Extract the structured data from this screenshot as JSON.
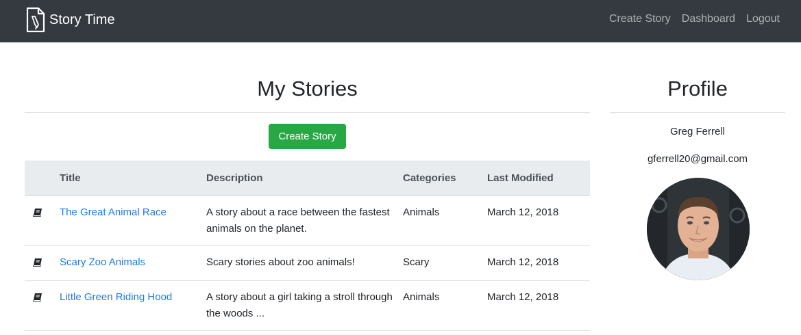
{
  "navbar": {
    "brand": "Story Time",
    "links": [
      "Create Story",
      "Dashboard",
      "Logout"
    ]
  },
  "main": {
    "title": "My Stories",
    "create_button": "Create Story",
    "table": {
      "headers": [
        "Title",
        "Description",
        "Categories",
        "Last Modified"
      ],
      "rows": [
        {
          "icon": "book-icon",
          "title": "The Great Animal Race",
          "description": "A story about a race between the fastest animals on the planet.",
          "category": "Animals",
          "modified": "March 12, 2018"
        },
        {
          "icon": "book-icon",
          "title": "Scary Zoo Animals",
          "description": "Scary stories about zoo animals!",
          "category": "Scary",
          "modified": "March 12, 2018"
        },
        {
          "icon": "book-icon",
          "title": "Little Green Riding Hood",
          "description": "A story about a girl taking a stroll through the woods ...",
          "category": "Animals",
          "modified": "March 12, 2018"
        }
      ]
    }
  },
  "profile": {
    "title": "Profile",
    "name": "Greg Ferrell",
    "email": "gferrell20@gmail.com",
    "avatar": "user-photo"
  },
  "colors": {
    "navbar_bg": "#343a40",
    "button_green": "#28a745",
    "link_blue": "#1f7ce0",
    "table_header_bg": "#e9ecef"
  }
}
